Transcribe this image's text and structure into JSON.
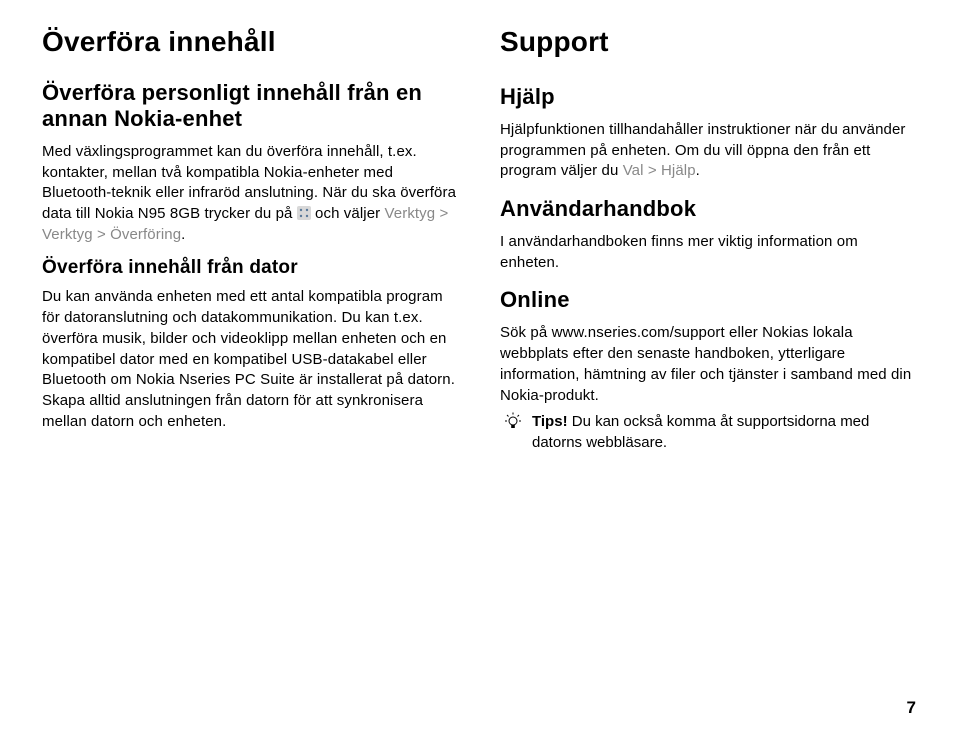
{
  "left": {
    "h1": "Överföra innehåll",
    "h2a": "Överföra personligt innehåll från en annan Nokia-enhet",
    "p1_pre": "Med växlingsprogrammet kan du överföra innehåll, t.ex. kontakter, mellan två kompatibla Nokia-enheter med Bluetooth-teknik eller infraröd anslutning. När du ska överföra data till Nokia N95 8GB trycker du på ",
    "p1_post_pre": " och väljer ",
    "p1_grey": "Verktyg > Verktyg > Överföring",
    "p1_end": ".",
    "h3": "Överföra innehåll från dator",
    "p2": "Du kan använda enheten med ett antal kompatibla program för datoranslutning och datakommunikation. Du kan t.ex. överföra musik, bilder och videoklipp mellan enheten och en kompatibel dator med en kompatibel USB-datakabel eller Bluetooth om Nokia Nseries PC Suite är installerat på datorn. Skapa alltid anslutningen från datorn för att synkronisera mellan datorn och enheten."
  },
  "right": {
    "h1": "Support",
    "h2a": "Hjälp",
    "p1_pre": "Hjälpfunktionen tillhandahåller instruktioner när du använder programmen på enheten. Om du vill öppna den från ett program väljer du ",
    "p1_grey": "Val > Hjälp",
    "p1_end": ".",
    "h2b": "Användarhandbok",
    "p2": "I användarhandboken finns mer viktig information om enheten.",
    "h2c": "Online",
    "p3": "Sök på www.nseries.com/support eller Nokias lokala webbplats efter den senaste handboken, ytterligare information, hämtning av filer och tjänster i samband med din Nokia-produkt.",
    "tip_label": "Tips!",
    "tip_body": " Du kan också komma åt supportsidorna med datorns webbläsare."
  },
  "page_number": "7"
}
